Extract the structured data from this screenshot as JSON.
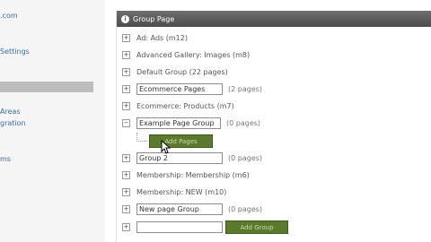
{
  "sidebar": {
    "items": [
      ".com",
      "Settings",
      "Areas",
      "gration",
      "ms"
    ]
  },
  "panel": {
    "title": "Group Page",
    "rows": [
      {
        "label": "Ad: Ads (m12)"
      },
      {
        "label": "Advanced Gallery: Images (m8)"
      },
      {
        "label": "Default Group (22 pages)"
      },
      {
        "label": "Ecommerce Pages",
        "count": "(2 pages)"
      },
      {
        "label": "Ecommerce: Products (m7)"
      },
      {
        "label": "Example Page Group",
        "count": "(0 pages)"
      },
      {
        "label": "Group 2",
        "count": "(0 pages)"
      },
      {
        "label": "Membership: Membership (m6)"
      },
      {
        "label": "Membership: NEW (m10)"
      },
      {
        "label": "New page Group",
        "count": "(0 pages)"
      }
    ],
    "add_pages_label": "Add Pages",
    "add_group_label": "Add Group",
    "new_group_input": ""
  }
}
